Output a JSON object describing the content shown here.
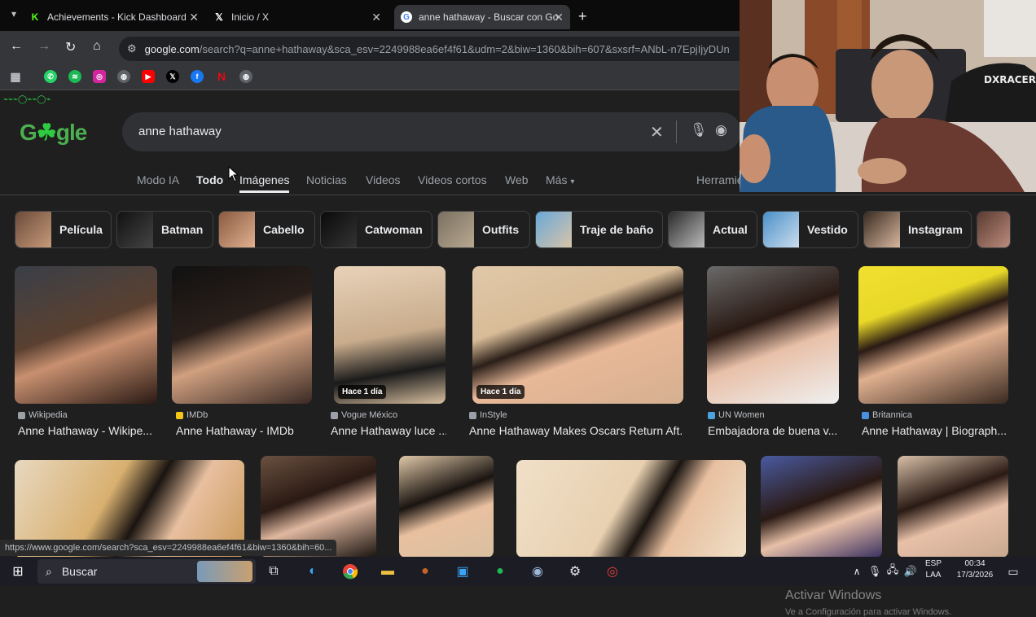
{
  "tabs": [
    {
      "title": "Achievements - Kick Dashboard",
      "icon": "kick-icon"
    },
    {
      "title": "Inicio / X",
      "icon": "x-icon"
    },
    {
      "title": "anne hathaway - Buscar con Go",
      "icon": "google-icon"
    }
  ],
  "address": {
    "host": "google.com",
    "rest": "/search?q=anne+hathaway&sca_esv=2249988ea6ef4f61&udm=2&biw=1360&bih=607&sxsrf=ANbL-n7EpjIjyDUn"
  },
  "bookmarks": [
    "apps-icon",
    "whatsapp-icon",
    "spotify-icon",
    "instagram-icon",
    "globe-icon",
    "youtube-icon",
    "x-icon",
    "facebook-icon",
    "netflix-icon",
    "globe-icon"
  ],
  "search": {
    "query": "anne hathaway"
  },
  "nav_tabs": {
    "modo_ia": "Modo IA",
    "todo": "Todo",
    "imagenes": "Imágenes",
    "noticias": "Noticias",
    "videos": "Videos",
    "videos_cortos": "Videos cortos",
    "web": "Web",
    "mas": "Más",
    "herramientas": "Herramie"
  },
  "chips": [
    "Película",
    "Batman",
    "Cabello",
    "Catwoman",
    "Outfits",
    "Traje de baño",
    "Actual",
    "Vestido",
    "Instagram"
  ],
  "results_row1": [
    {
      "source": "Wikipedia",
      "title": "Anne Hathaway - Wikipe...",
      "badge": ""
    },
    {
      "source": "IMDb",
      "title": "Anne Hathaway - IMDb",
      "badge": ""
    },
    {
      "source": "Vogue México",
      "title": "Anne Hathaway luce ...",
      "badge": "Hace 1 día"
    },
    {
      "source": "InStyle",
      "title": "Anne Hathaway Makes Oscars Return Aft...",
      "badge": "Hace 1 día"
    },
    {
      "source": "UN Women",
      "title": "Embajadora de buena v...",
      "badge": ""
    },
    {
      "source": "Britannica",
      "title": "Anne Hathaway | Biograph...",
      "badge": ""
    }
  ],
  "status_url": "https://www.google.com/search?sca_esv=2249988ea6ef4f61&biw=1360&bih=60...",
  "watermark": {
    "line1": "Activar Windows",
    "line2": "Ve a Configuración para activar Windows."
  },
  "taskbar": {
    "search_placeholder": "Buscar",
    "lang": "ESP",
    "layout": "LAA",
    "time": "00:34",
    "date": "17/3/2026"
  },
  "colors": {
    "page_bg": "#1f1f1f",
    "search_bg": "#303134",
    "tabbar_bg": "#0b0b0b",
    "logo": "#4caf50"
  }
}
